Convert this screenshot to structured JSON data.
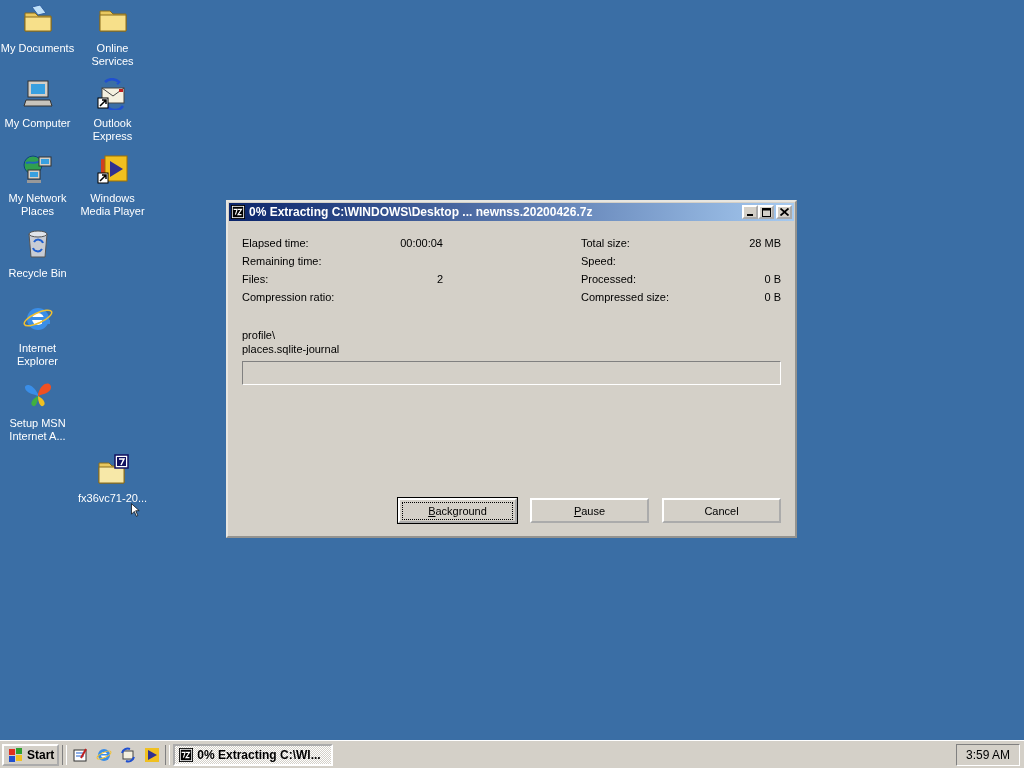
{
  "desktop_icons": [
    {
      "label": "My Documents",
      "kind": "documents",
      "shortcut": false
    },
    {
      "label": "Online Services",
      "kind": "folder",
      "shortcut": false
    },
    {
      "label": "My Computer",
      "kind": "computer",
      "shortcut": false
    },
    {
      "label": "Outlook Express",
      "kind": "mail",
      "shortcut": true
    },
    {
      "label": "My Network Places",
      "kind": "network",
      "shortcut": false
    },
    {
      "label": "Windows Media Player",
      "kind": "media",
      "shortcut": true
    },
    {
      "label": "Recycle Bin",
      "kind": "bin",
      "shortcut": false
    },
    {
      "label": "Internet Explorer",
      "kind": "browser",
      "shortcut": false
    },
    {
      "label": "Setup MSN Internet A...",
      "kind": "butterfly",
      "shortcut": false
    },
    {
      "label": "fx36vc71-20...",
      "kind": "archive",
      "shortcut": false
    }
  ],
  "window": {
    "title": "0% Extracting C:\\WINDOWS\\Desktop ... newnss.20200426.7z",
    "stats_left": [
      {
        "label": "Elapsed time:",
        "value": "00:00:04"
      },
      {
        "label": "Remaining time:"
      },
      {
        "label": "Files:",
        "value": "2"
      },
      {
        "label": "Compression ratio:"
      }
    ],
    "stats_right": [
      {
        "label": "Total size:",
        "value": "28 MB"
      },
      {
        "label": "Speed:"
      },
      {
        "label": "Processed:",
        "value": "0 B"
      },
      {
        "label": "Compressed size:",
        "value": "0 B"
      }
    ],
    "current_path": [
      "profile\\",
      "places.sqlite-journal"
    ],
    "progress": {
      "level": 0
    },
    "buttons": [
      {
        "label": "Background",
        "first_letter_underlined": true,
        "default": true
      },
      {
        "label": "Pause",
        "first_letter_underlined": true,
        "default": false
      },
      {
        "label": "Cancel",
        "first_letter_underlined": false,
        "default": false
      }
    ]
  },
  "taskbar": {
    "start": "Start",
    "quick_launch": [
      {
        "kind": "desktop"
      },
      {
        "kind": "browser"
      },
      {
        "kind": "channels"
      },
      {
        "kind": "media"
      }
    ],
    "tasks": [
      {
        "label": "0% Extracting C:\\WI...",
        "selected": true
      }
    ],
    "clock": "3:59 AM"
  }
}
